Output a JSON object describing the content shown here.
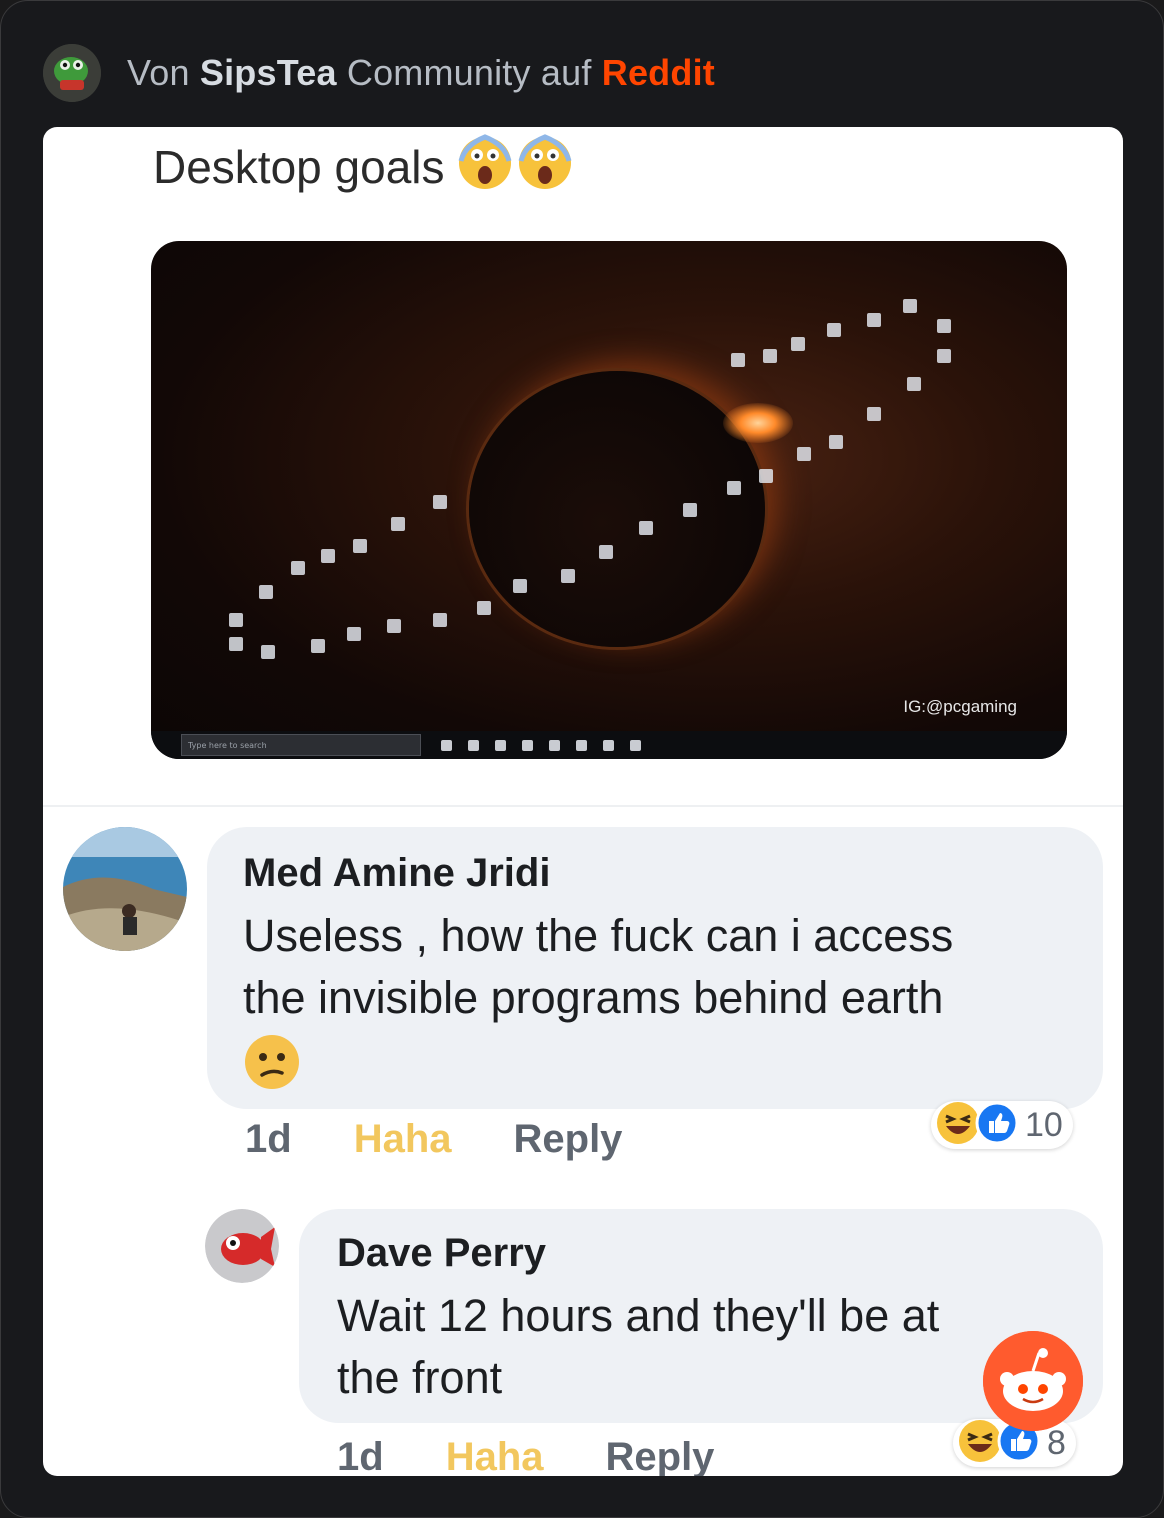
{
  "header": {
    "prefix": "Von",
    "subreddit": "SipsTea",
    "middle": "Community auf",
    "platform": "Reddit"
  },
  "post": {
    "title": "Desktop goals",
    "emoji": "😱😱",
    "screenshot": {
      "watermark": "IG:@pcgaming",
      "search_placeholder": "Type here to search"
    }
  },
  "comments": [
    {
      "author": "Med Amine Jridi",
      "text_line1": "Useless , how the fuck can i access",
      "text_line2": "the invisible programs behind earth",
      "emoji": "😕",
      "time": "1d",
      "haha_label": "Haha",
      "reply_label": "Reply",
      "reaction_count": "10"
    },
    {
      "author": "Dave  Perry",
      "text_line1": "Wait 12 hours and they'll be at",
      "text_line2": "the front",
      "time": "1d",
      "haha_label": "Haha",
      "reply_label": "Reply",
      "reaction_count": "8"
    }
  ],
  "colors": {
    "reddit_orange": "#ff4500",
    "haha_yellow": "#f2c75e",
    "like_blue": "#1877f2",
    "bubble": "#eef1f5"
  }
}
